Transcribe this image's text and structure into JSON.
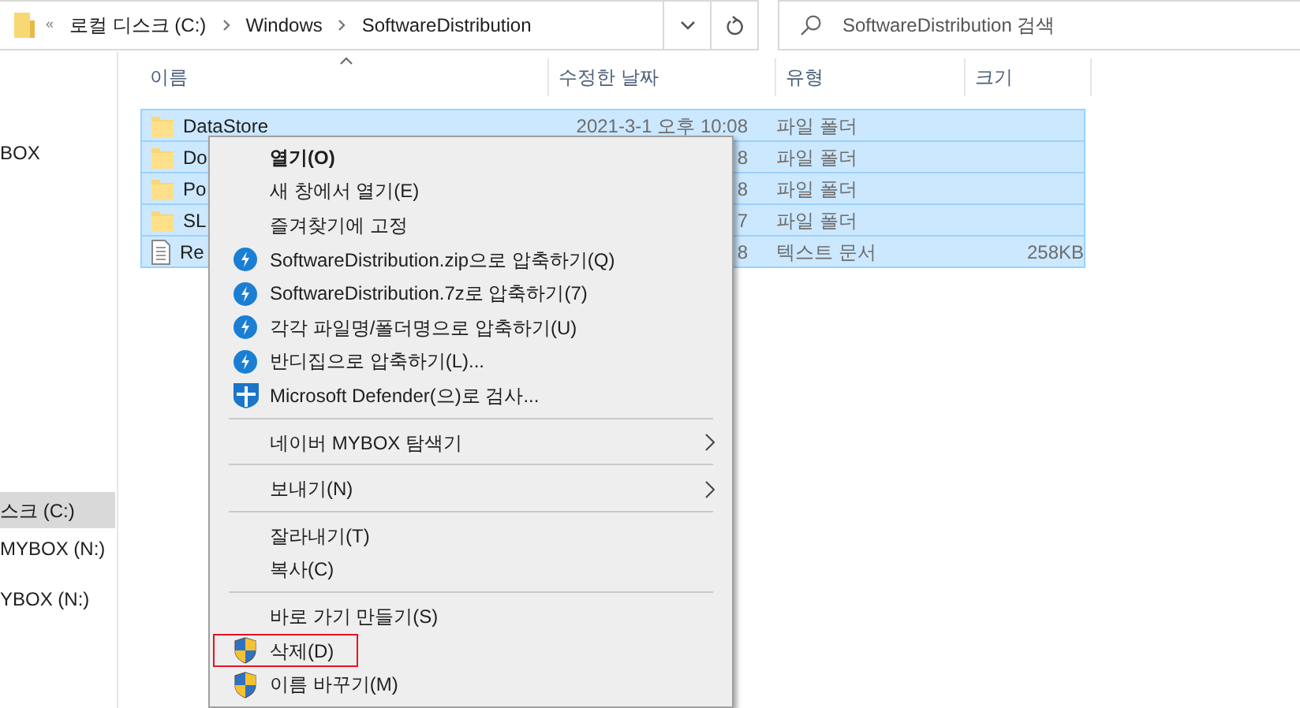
{
  "address_bar": {
    "overflow": "«",
    "breadcrumbs": [
      "로컬 디스크 (C:)",
      "Windows",
      "SoftwareDistribution"
    ]
  },
  "search": {
    "placeholder": "SoftwareDistribution 검색"
  },
  "sidebar": {
    "items": [
      {
        "label": "BOX",
        "selected": false
      },
      {
        "label": "스크 (C:)",
        "selected": true
      },
      {
        "label": "MYBOX (N:)",
        "selected": false
      },
      {
        "label": "YBOX (N:)",
        "selected": false
      }
    ]
  },
  "table": {
    "columns": [
      "이름",
      "수정한 날짜",
      "유형",
      "크기"
    ],
    "rows": [
      {
        "kind": "folder",
        "name": "DataStore",
        "modified": "2021-3-1 오후 10:08",
        "type": "파일 폴더",
        "size": "",
        "selected": true
      },
      {
        "kind": "folder",
        "name": "Do",
        "modified": "8",
        "type": "파일 폴더",
        "size": "",
        "selected": true
      },
      {
        "kind": "folder",
        "name": "Po",
        "modified": "8",
        "type": "파일 폴더",
        "size": "",
        "selected": true
      },
      {
        "kind": "folder",
        "name": "SL",
        "modified": "7",
        "type": "파일 폴더",
        "size": "",
        "selected": true
      },
      {
        "kind": "text",
        "name": "Re",
        "modified": "8",
        "type": "텍스트 문서",
        "size": "258KB",
        "selected": true
      }
    ]
  },
  "context_menu": {
    "items": [
      {
        "kind": "plain",
        "label": "열기(O)",
        "default": true
      },
      {
        "kind": "plain",
        "label": "새 창에서 열기(E)"
      },
      {
        "kind": "plain",
        "label": "즐겨찾기에 고정"
      },
      {
        "kind": "bandizip",
        "label": "SoftwareDistribution.zip으로 압축하기(Q)"
      },
      {
        "kind": "bandizip",
        "label": "SoftwareDistribution.7z로 압축하기(7)"
      },
      {
        "kind": "bandizip",
        "label": "각각 파일명/폴더명으로 압축하기(U)"
      },
      {
        "kind": "bandizip",
        "label": "반디집으로 압축하기(L)..."
      },
      {
        "kind": "defender",
        "label": "Microsoft Defender(으)로 검사..."
      },
      {
        "kind": "separator"
      },
      {
        "kind": "plain",
        "label": "네이버 MYBOX 탐색기",
        "submenu": true
      },
      {
        "kind": "separator"
      },
      {
        "kind": "plain",
        "label": "보내기(N)",
        "submenu": true
      },
      {
        "kind": "separator"
      },
      {
        "kind": "plain",
        "label": "잘라내기(T)"
      },
      {
        "kind": "plain",
        "label": "복사(C)"
      },
      {
        "kind": "separator"
      },
      {
        "kind": "plain",
        "label": "바로 가기 만들기(S)"
      },
      {
        "kind": "shield",
        "label": "삭제(D)",
        "outlined": true
      },
      {
        "kind": "shield",
        "label": "이름 바꾸기(M)"
      }
    ]
  }
}
